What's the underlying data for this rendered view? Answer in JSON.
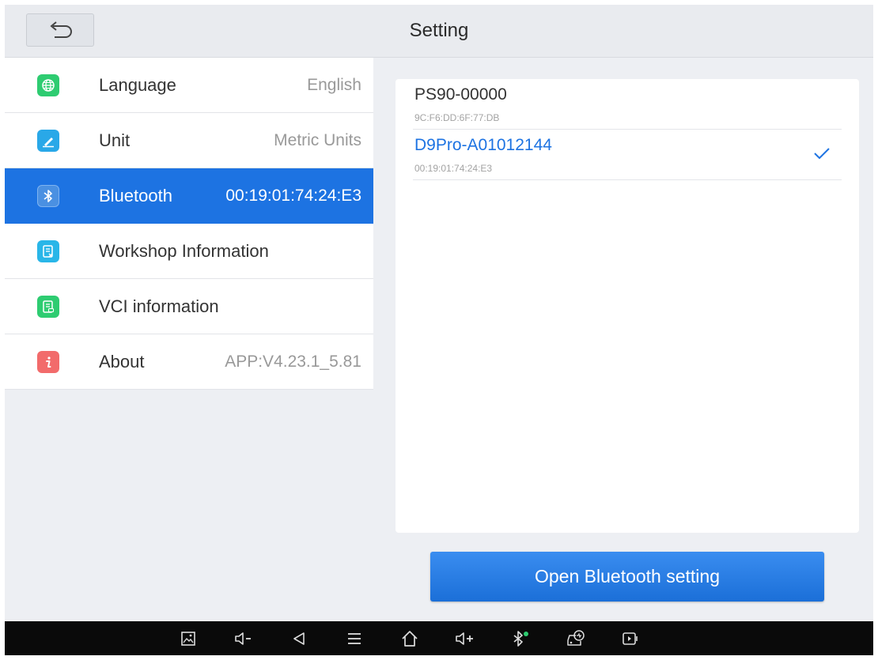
{
  "header": {
    "title": "Setting",
    "back_icon": "back-arrow-icon"
  },
  "sidebar": {
    "items": [
      {
        "label": "Language",
        "value": "English",
        "icon": "globe-icon",
        "icon_color": "#2ecc71"
      },
      {
        "label": "Unit",
        "value": "Metric Units",
        "icon": "ruler-icon",
        "icon_color": "#29a8e8"
      },
      {
        "label": "Bluetooth",
        "value": "00:19:01:74:24:E3",
        "icon": "bluetooth-icon",
        "icon_color": "#4a90e2",
        "active": true
      },
      {
        "label": "Workshop Information",
        "value": "",
        "icon": "workshop-doc-icon",
        "icon_color": "#29b6e8"
      },
      {
        "label": "VCI information",
        "value": "",
        "icon": "vci-doc-icon",
        "icon_color": "#2ecc71"
      },
      {
        "label": "About",
        "value": "APP:V4.23.1_5.81",
        "icon": "info-icon",
        "icon_color": "#f26b6b"
      }
    ]
  },
  "devices": [
    {
      "name": "PS90-00000",
      "mac": "9C:F6:DD:6F:77:DB",
      "connected": false
    },
    {
      "name": "D9Pro-A01012144",
      "mac": "00:19:01:74:24:E3",
      "connected": true
    }
  ],
  "open_bluetooth_button": "Open Bluetooth setting",
  "nav_bar": {
    "icons": [
      "screenshot-icon",
      "volume-down-icon",
      "back-icon",
      "menu-icon",
      "home-icon",
      "volume-up-icon",
      "bluetooth-status-icon",
      "car-diagnostics-icon",
      "screen-record-icon"
    ]
  },
  "colors": {
    "accent": "#1d73e2",
    "sidebar_active_bg": "#1d73e2",
    "panel_bg": "#edeff3"
  }
}
